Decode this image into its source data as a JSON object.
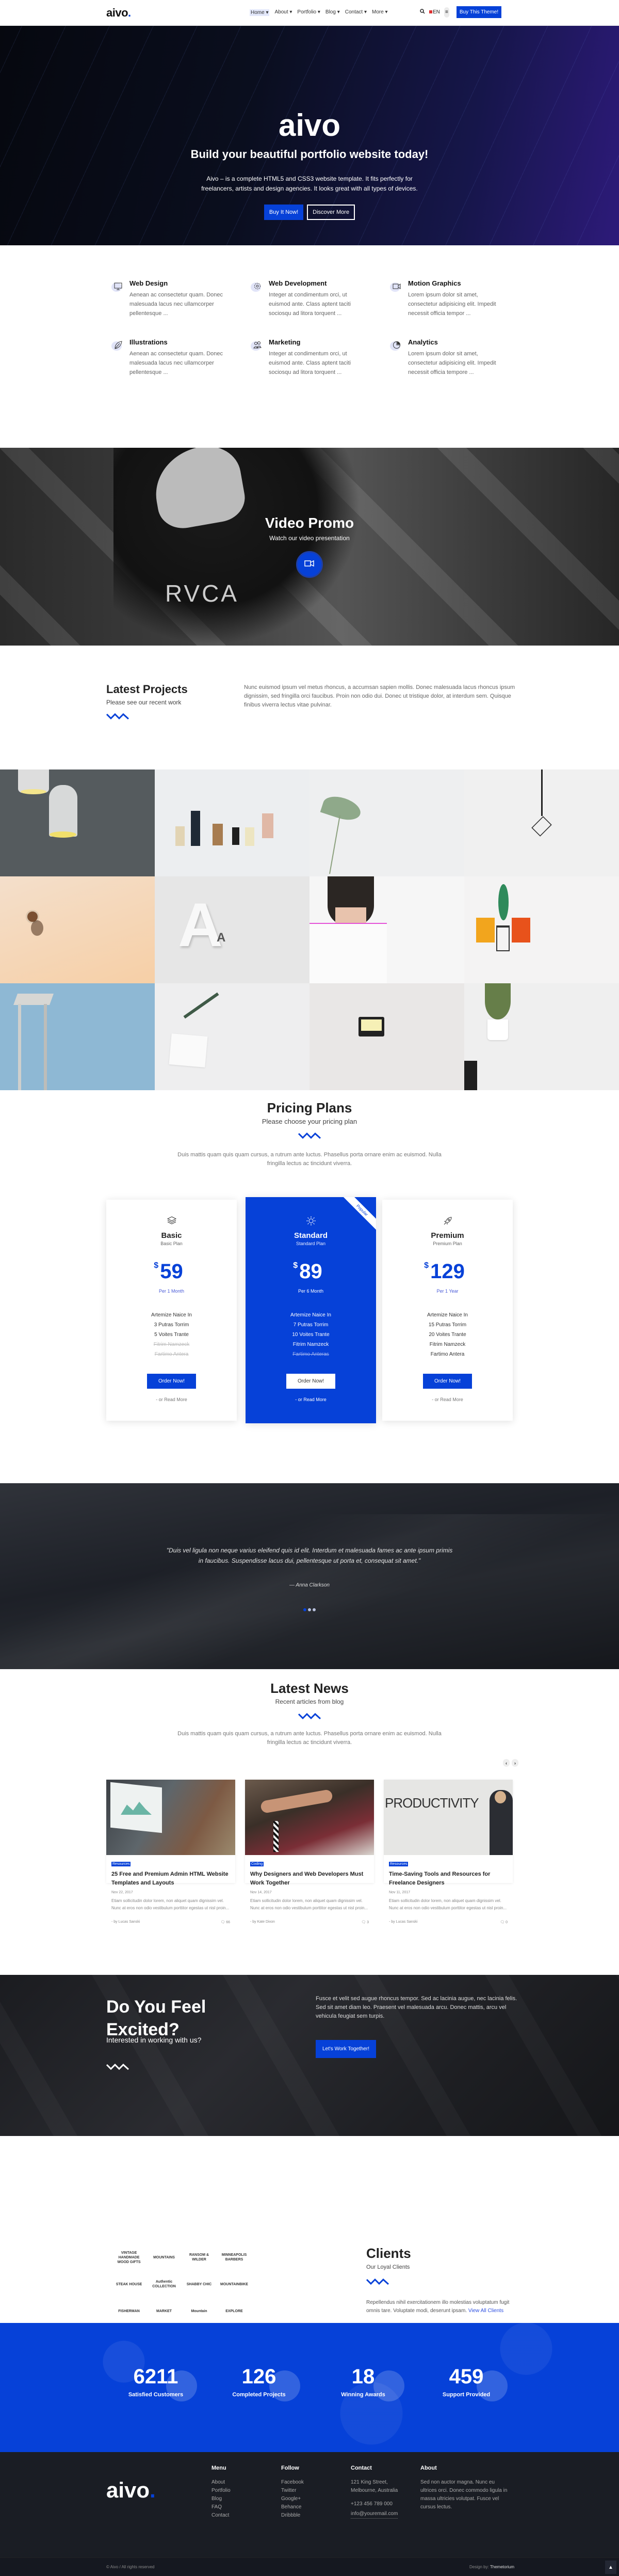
{
  "nav": {
    "logo": "aivo",
    "menu": [
      {
        "label": "Home ▾",
        "active": true
      },
      {
        "label": "About ▾"
      },
      {
        "label": "Portfolio ▾"
      },
      {
        "label": "Blog ▾"
      },
      {
        "label": "Contact ▾"
      },
      {
        "label": "More ▾"
      }
    ],
    "search_icon": "search-icon",
    "language": "EN",
    "menu_icon": "hamburger-icon",
    "buy_button": "Buy This Theme!"
  },
  "hero": {
    "title": "aivo",
    "subtitle": "Build your beautiful portfolio website today!",
    "description_line1": "Aivo – is a complete HTML5 and CSS3 website template. It fits perfectly for",
    "description_line2": "freelancers, artists and design agencies. It looks great with all types of devices.",
    "primary_button": "Buy It Now!",
    "secondary_button": "Discover More"
  },
  "services": [
    {
      "icon": "monitor-icon",
      "title": "Web Design",
      "text": "Aenean ac consectetur quam. Donec malesuada lacus nec ullamcorper pellentesque ..."
    },
    {
      "icon": "gear-icon",
      "title": "Web Development",
      "text": "Integer at condimentum orci, ut euismod ante. Class aptent taciti sociosqu ad litora torquent ..."
    },
    {
      "icon": "video-camera-icon",
      "title": "Motion Graphics",
      "text": "Lorem ipsum dolor sit amet, consectetur adipisicing elit. Impedit necessit officia tempor ..."
    },
    {
      "icon": "leaf-icon",
      "title": "Illustrations",
      "text": "Aenean ac consectetur quam. Donec malesuada lacus nec ullamcorper pellentesque ..."
    },
    {
      "icon": "users-icon",
      "title": "Marketing",
      "text": "Integer at condimentum orci, ut euismod ante. Class aptent taciti sociosqu ad litora torquent ..."
    },
    {
      "icon": "pie-chart-icon",
      "title": "Analytics",
      "text": "Lorem ipsum dolor sit amet, consectetur adipisicing elit. Impedit necessit officia tempore ..."
    }
  ],
  "video": {
    "title": "Video Promo",
    "subtitle": "Watch our video presentation",
    "shirt_text": "RVCA"
  },
  "projects": {
    "title": "Latest Projects",
    "subtitle": "Please see our recent work",
    "description": "Nunc euismod ipsum vel metus rhoncus, a accumsan sapien mollis. Donec malesuada lacus rhoncus ipsum dignissim, sed fringilla orci faucibus. Proin non odio dui. Donec ut tristique dolor, at interdum sem. Quisque finibus viverra lectus vitae pulvinar.",
    "items": [
      {
        "name": "pendant-lamps"
      },
      {
        "name": "paper-tags"
      },
      {
        "name": "green-leaf"
      },
      {
        "name": "cage-bulb"
      },
      {
        "name": "coffee-cup"
      },
      {
        "name": "letter-a",
        "text": "A",
        "small": "A"
      },
      {
        "name": "girl-under-blanket"
      },
      {
        "name": "chairs-illustration"
      },
      {
        "name": "wooden-stool"
      },
      {
        "name": "leaf-card"
      },
      {
        "name": "cassette-tape"
      },
      {
        "name": "potted-palm"
      }
    ]
  },
  "pricing": {
    "title": "Pricing Plans",
    "subtitle": "Please choose your pricing plan",
    "description": "Duis mattis quam quis quam cursus, a rutrum ante luctus. Phasellus porta ornare enim ac euismod. Nulla fringilla lectus ac tincidunt viverra.",
    "plans": [
      {
        "icon": "layers-icon",
        "name": "Basic",
        "desc": "Basic Plan",
        "currency": "$",
        "price": "59",
        "period": "Per 1 Month",
        "features": [
          {
            "text": "Artemize Naice In",
            "included": true
          },
          {
            "text": "3 Putras Torrim",
            "included": true
          },
          {
            "text": "5 Voites Trante",
            "included": true
          },
          {
            "text": "Fitrim Namzeck",
            "included": false
          },
          {
            "text": "Fartimo Antera",
            "included": false
          }
        ],
        "button": "Order Now!",
        "more": "- or Read More",
        "featured": false
      },
      {
        "icon": "sun-icon",
        "name": "Standard",
        "desc": "Standard Plan",
        "currency": "$",
        "price": "89",
        "period": "Per 6 Month",
        "features": [
          {
            "text": "Artemize Naice In",
            "included": true
          },
          {
            "text": "7 Putras Torrim",
            "included": true
          },
          {
            "text": "10 Voites Trante",
            "included": true
          },
          {
            "text": "Fitrim Namzeck",
            "included": true
          },
          {
            "text": "Fartimo Anteras",
            "included": false
          }
        ],
        "button": "Order Now!",
        "more": "- or Read More",
        "featured": true,
        "badge": "Popular"
      },
      {
        "icon": "rocket-icon",
        "name": "Premium",
        "desc": "Premium Plan",
        "currency": "$",
        "price": "129",
        "period": "Per 1 Year",
        "features": [
          {
            "text": "Artemize Naice In",
            "included": true
          },
          {
            "text": "15 Putras Torrim",
            "included": true
          },
          {
            "text": "20 Voites Trante",
            "included": true
          },
          {
            "text": "Fitrim Namzeck",
            "included": true
          },
          {
            "text": "Fartimo Antera",
            "included": true
          }
        ],
        "button": "Order Now!",
        "more": "- or Read More",
        "featured": false
      }
    ]
  },
  "testimonial": {
    "quote": "\"Duis vel ligula non neque varius eleifend quis id elit. Interdum et malesuada fames ac ante ipsum primis in faucibus. Suspendisse lacus dui, pellentesque ut porta et, consequat sit amet.\"",
    "author": "— Anna Clarkson",
    "slides": 3,
    "active_slide": 0
  },
  "news": {
    "title": "Latest News",
    "subtitle": "Recent articles from blog",
    "description": "Duis mattis quam quis quam cursus, a rutrum ante luctus. Phasellus porta ornare enim ac euismod. Nulla fringilla lectus ac tincidunt viverra.",
    "prev": "‹",
    "next": "›",
    "posts": [
      {
        "tag": "Resources",
        "title": "25 Free and Premium Admin HTML Website Templates and Layouts",
        "date": "Nov 22, 2017",
        "excerpt": "Etiam sollicitudin dolor lorem, non aliquet quam dignissim vel. Nunc at eros non odio vestibulum porttitor egestas ut nisl proin...",
        "author": "- by Lucas Sanski",
        "comments": "66",
        "image": "laptop-dashboard"
      },
      {
        "tag": "Coding",
        "title": "Why Designers and Web Developers Must Work Together",
        "date": "Nov 14, 2017",
        "excerpt": "Etiam sollicitudin dolor lorem, non aliquet quam dignissim vel. Nunc at eros non odio vestibulum porttitor egestas ut nisl proin...",
        "author": "- by Kate Dixon",
        "comments": "3",
        "image": "team-fist-bump"
      },
      {
        "tag": "Resources",
        "title": "Time-Saving Tools and Resources for Freelance Designers",
        "date": "Nov 11, 2017",
        "excerpt": "Etiam sollicitudin dolor lorem, non aliquet quam dignissim vel. Nunc at eros non odio vestibulum porttitor egestas ut nisl proin...",
        "author": "- by Lucas Sanski",
        "comments": "0",
        "image": "productivity-wall"
      }
    ]
  },
  "cta": {
    "title_line1": "Do You Feel",
    "title_line2": "Excited?",
    "subtitle": "Interested in working with us?",
    "description": "Fusce et velit sed augue rhoncus tempor. Sed ac lacinia augue, nec lacinia felis. Sed sit amet diam leo. Praesent vel malesuada arcu. Donec mattis, arcu vel vehicula feugiat sem turpis.",
    "button": "Let's Work Together!"
  },
  "clients": {
    "title": "Clients",
    "subtitle": "Our Loyal Clients",
    "description": "Repellendus nihil exercitationem illo molestias voluptatum fugit omnis tare. Voluptate modi, deserunt ipsam.",
    "link": "View All Clients",
    "logos": [
      "VINTAGE HANDMADE WOOD GIFTS",
      "MOUNTAINS",
      "RANSOM & WILDER",
      "MINNEAPOLIS BARBERS",
      "STEAK HOUSE",
      "Authentic COLLECTION",
      "SHABBY CHIC",
      "MOUNTAINBIKE",
      "FISHERMAN",
      "MARKET",
      "Mountain",
      "EXPLORE"
    ]
  },
  "stats": [
    {
      "value": "6211",
      "label": "Satisfied Customers",
      "icon": "users-icon"
    },
    {
      "value": "126",
      "label": "Completed Projects",
      "icon": "leaf-icon"
    },
    {
      "value": "18",
      "label": "Winning Awards",
      "icon": "trophy-icon"
    },
    {
      "value": "459",
      "label": "Support Provided",
      "icon": "lifebuoy-icon"
    }
  ],
  "footer": {
    "logo": "aivo",
    "menu": {
      "title": "Menu",
      "items": [
        "About",
        "Portfolio",
        "Blog",
        "FAQ",
        "Contact"
      ]
    },
    "follow": {
      "title": "Follow",
      "items": [
        "Facebook",
        "Twitter",
        "Google+",
        "Behance",
        "Dribbble"
      ]
    },
    "contact": {
      "title": "Contact",
      "address1": "121 King Street,",
      "address2": "Melbourne, Australia",
      "phone": "+123 456 789 000",
      "email": "info@youremail.com"
    },
    "about": {
      "title": "About",
      "text": "Sed non auctor magna. Nunc eu ultrices orci. Donec commodo ligula in massa ultricies volutpat. Fusce vel cursus lectus."
    },
    "copyright": "© Aivo / All rights reserved",
    "design_by_label": "Design by:",
    "design_by": "Themetorium",
    "to_top": "▲"
  },
  "colors": {
    "accent": "#0641d8",
    "dark": "#1a1d24"
  }
}
